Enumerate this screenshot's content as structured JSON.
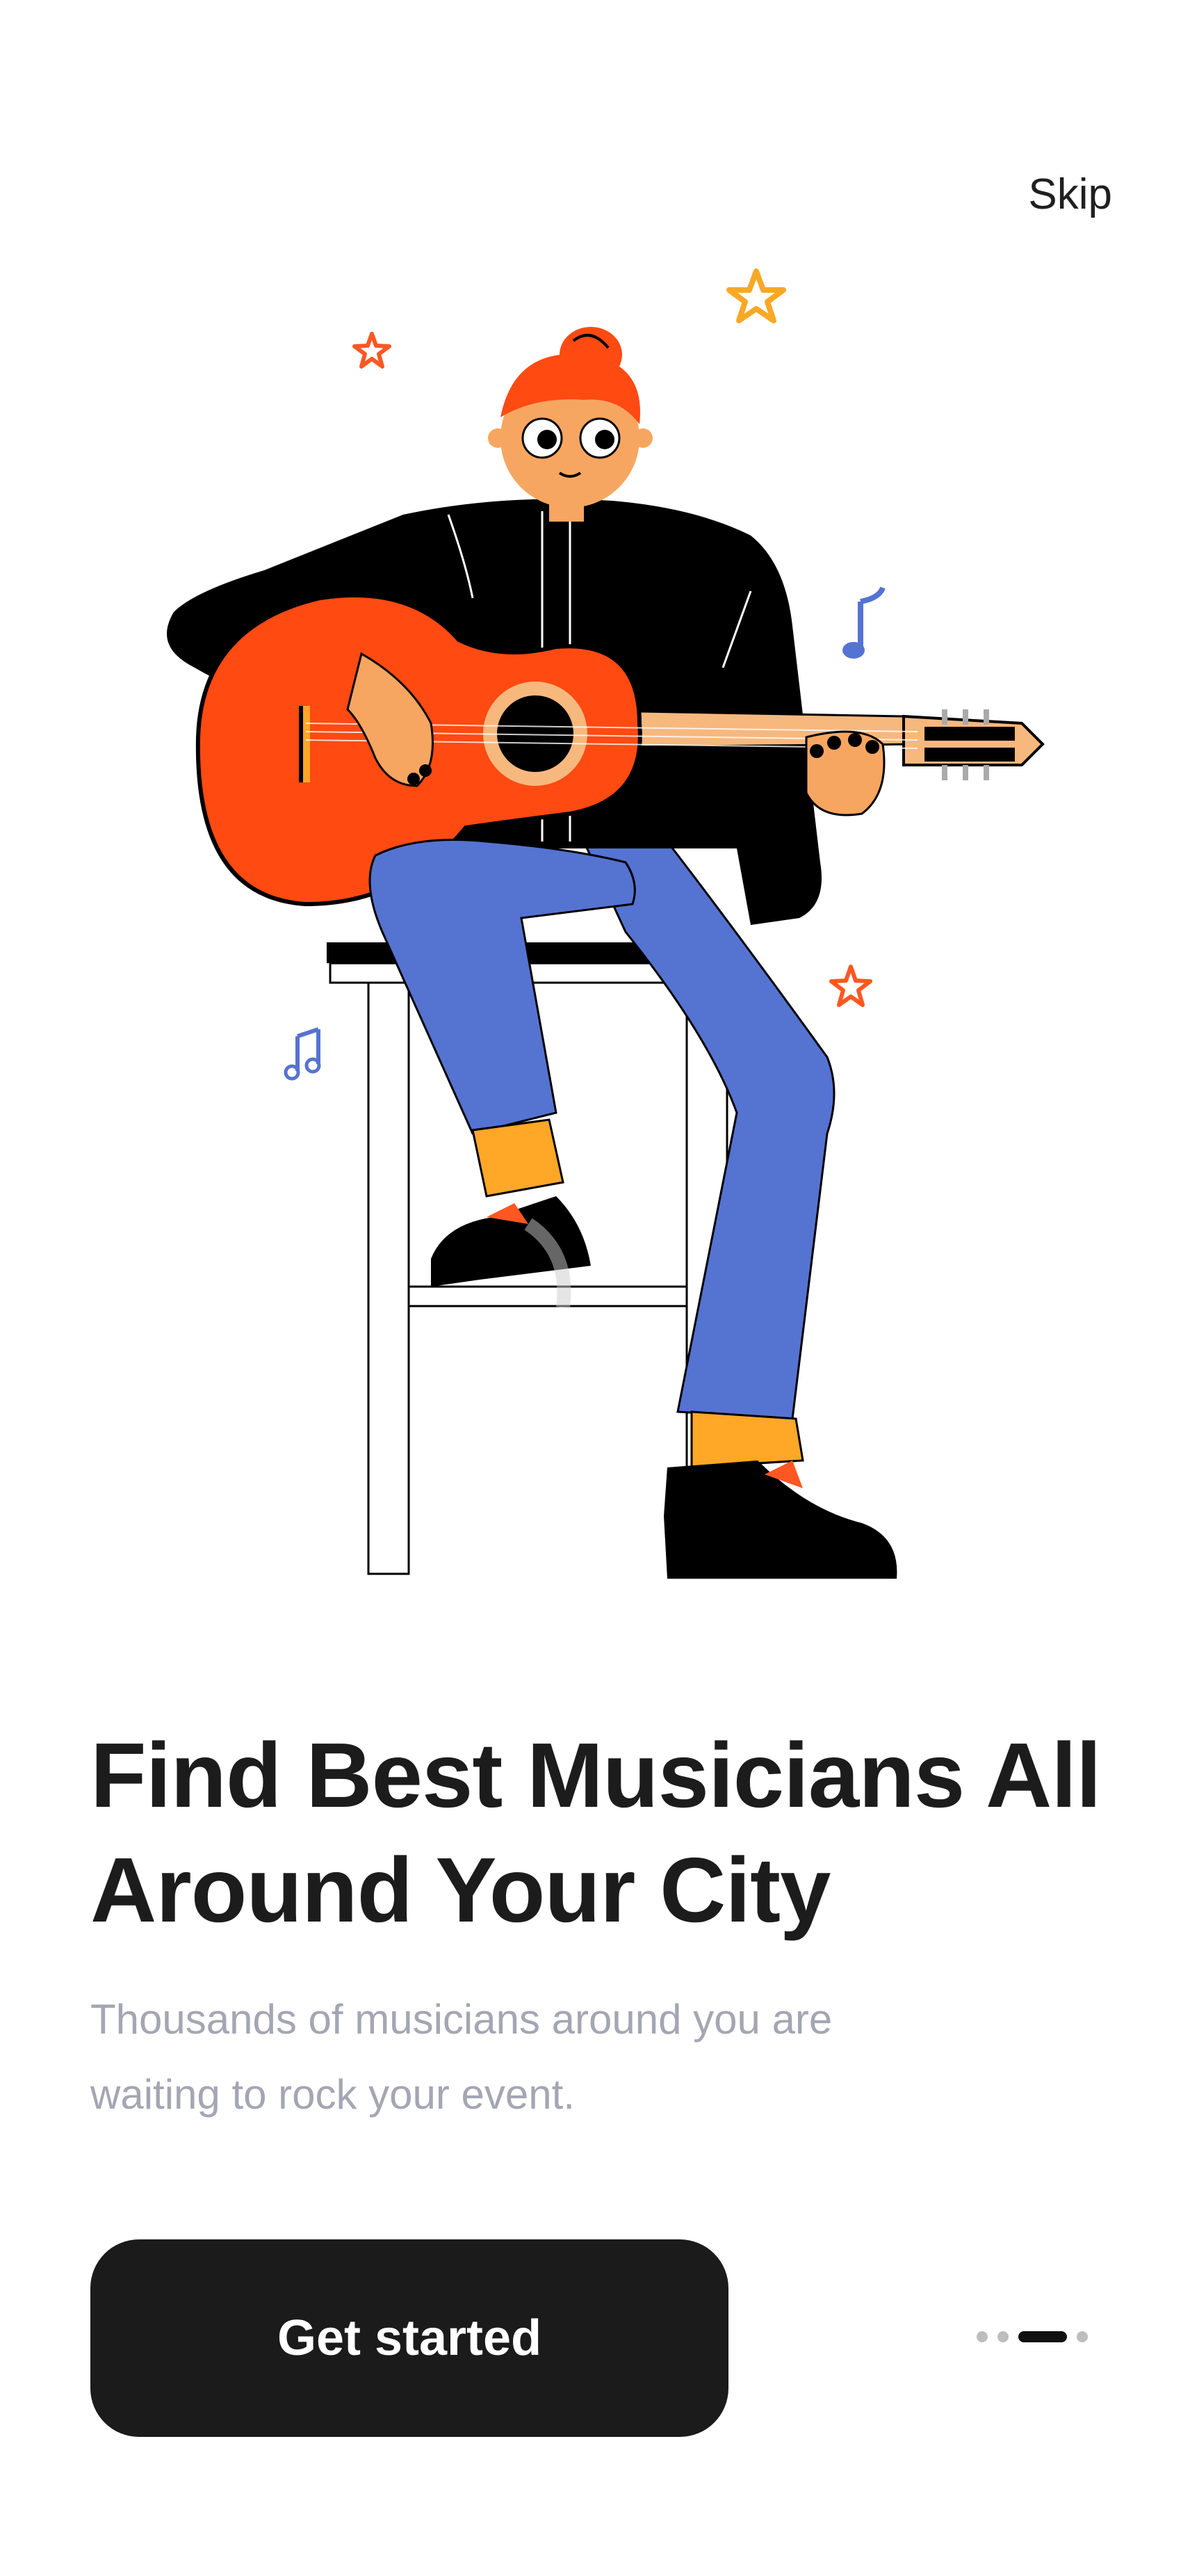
{
  "header": {
    "skip_label": "Skip"
  },
  "illustration": {
    "subject": "musician-playing-guitar-illustration",
    "colors": {
      "guitar": "#ff4a12",
      "hair": "#ff4a12",
      "skin": "#f7a661",
      "jacket": "#000000",
      "pants": "#5573d1",
      "socks": "#ffa726",
      "star_orange": "#ff5722",
      "star_yellow": "#f9a825",
      "note_blue": "#5573d1"
    }
  },
  "main": {
    "title_line1": "Find Best Musicians All",
    "title_line2": "Around Your City",
    "subtitle_line1": "Thousands of musicians around you are",
    "subtitle_line2": "waiting to rock your event.",
    "cta_label": "Get started"
  },
  "pager": {
    "total": 4,
    "active_index": 2
  },
  "theme": {
    "text_primary": "#1c1c1c",
    "text_secondary": "#a4a6b3",
    "button_bg": "#1b1b1b",
    "button_text": "#ffffff"
  }
}
